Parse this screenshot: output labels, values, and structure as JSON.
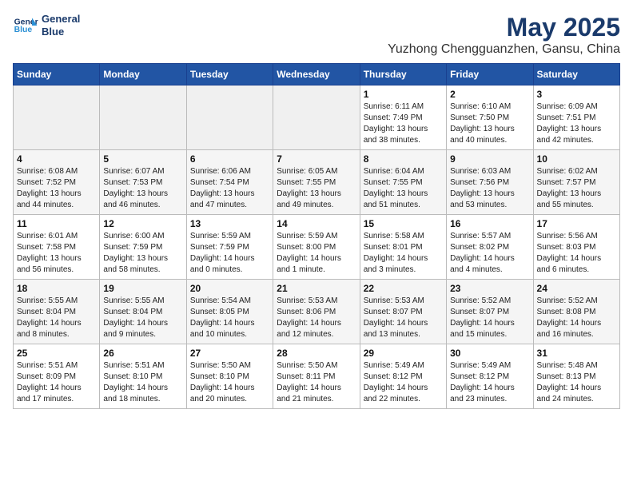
{
  "header": {
    "logo_line1": "General",
    "logo_line2": "Blue",
    "title": "May 2025",
    "subtitle": "Yuzhong Chengguanzhen, Gansu, China"
  },
  "weekdays": [
    "Sunday",
    "Monday",
    "Tuesday",
    "Wednesday",
    "Thursday",
    "Friday",
    "Saturday"
  ],
  "weeks": [
    [
      {
        "day": "",
        "info": ""
      },
      {
        "day": "",
        "info": ""
      },
      {
        "day": "",
        "info": ""
      },
      {
        "day": "",
        "info": ""
      },
      {
        "day": "1",
        "info": "Sunrise: 6:11 AM\nSunset: 7:49 PM\nDaylight: 13 hours\nand 38 minutes."
      },
      {
        "day": "2",
        "info": "Sunrise: 6:10 AM\nSunset: 7:50 PM\nDaylight: 13 hours\nand 40 minutes."
      },
      {
        "day": "3",
        "info": "Sunrise: 6:09 AM\nSunset: 7:51 PM\nDaylight: 13 hours\nand 42 minutes."
      }
    ],
    [
      {
        "day": "4",
        "info": "Sunrise: 6:08 AM\nSunset: 7:52 PM\nDaylight: 13 hours\nand 44 minutes."
      },
      {
        "day": "5",
        "info": "Sunrise: 6:07 AM\nSunset: 7:53 PM\nDaylight: 13 hours\nand 46 minutes."
      },
      {
        "day": "6",
        "info": "Sunrise: 6:06 AM\nSunset: 7:54 PM\nDaylight: 13 hours\nand 47 minutes."
      },
      {
        "day": "7",
        "info": "Sunrise: 6:05 AM\nSunset: 7:55 PM\nDaylight: 13 hours\nand 49 minutes."
      },
      {
        "day": "8",
        "info": "Sunrise: 6:04 AM\nSunset: 7:55 PM\nDaylight: 13 hours\nand 51 minutes."
      },
      {
        "day": "9",
        "info": "Sunrise: 6:03 AM\nSunset: 7:56 PM\nDaylight: 13 hours\nand 53 minutes."
      },
      {
        "day": "10",
        "info": "Sunrise: 6:02 AM\nSunset: 7:57 PM\nDaylight: 13 hours\nand 55 minutes."
      }
    ],
    [
      {
        "day": "11",
        "info": "Sunrise: 6:01 AM\nSunset: 7:58 PM\nDaylight: 13 hours\nand 56 minutes."
      },
      {
        "day": "12",
        "info": "Sunrise: 6:00 AM\nSunset: 7:59 PM\nDaylight: 13 hours\nand 58 minutes."
      },
      {
        "day": "13",
        "info": "Sunrise: 5:59 AM\nSunset: 7:59 PM\nDaylight: 14 hours\nand 0 minutes."
      },
      {
        "day": "14",
        "info": "Sunrise: 5:59 AM\nSunset: 8:00 PM\nDaylight: 14 hours\nand 1 minute."
      },
      {
        "day": "15",
        "info": "Sunrise: 5:58 AM\nSunset: 8:01 PM\nDaylight: 14 hours\nand 3 minutes."
      },
      {
        "day": "16",
        "info": "Sunrise: 5:57 AM\nSunset: 8:02 PM\nDaylight: 14 hours\nand 4 minutes."
      },
      {
        "day": "17",
        "info": "Sunrise: 5:56 AM\nSunset: 8:03 PM\nDaylight: 14 hours\nand 6 minutes."
      }
    ],
    [
      {
        "day": "18",
        "info": "Sunrise: 5:55 AM\nSunset: 8:04 PM\nDaylight: 14 hours\nand 8 minutes."
      },
      {
        "day": "19",
        "info": "Sunrise: 5:55 AM\nSunset: 8:04 PM\nDaylight: 14 hours\nand 9 minutes."
      },
      {
        "day": "20",
        "info": "Sunrise: 5:54 AM\nSunset: 8:05 PM\nDaylight: 14 hours\nand 10 minutes."
      },
      {
        "day": "21",
        "info": "Sunrise: 5:53 AM\nSunset: 8:06 PM\nDaylight: 14 hours\nand 12 minutes."
      },
      {
        "day": "22",
        "info": "Sunrise: 5:53 AM\nSunset: 8:07 PM\nDaylight: 14 hours\nand 13 minutes."
      },
      {
        "day": "23",
        "info": "Sunrise: 5:52 AM\nSunset: 8:07 PM\nDaylight: 14 hours\nand 15 minutes."
      },
      {
        "day": "24",
        "info": "Sunrise: 5:52 AM\nSunset: 8:08 PM\nDaylight: 14 hours\nand 16 minutes."
      }
    ],
    [
      {
        "day": "25",
        "info": "Sunrise: 5:51 AM\nSunset: 8:09 PM\nDaylight: 14 hours\nand 17 minutes."
      },
      {
        "day": "26",
        "info": "Sunrise: 5:51 AM\nSunset: 8:10 PM\nDaylight: 14 hours\nand 18 minutes."
      },
      {
        "day": "27",
        "info": "Sunrise: 5:50 AM\nSunset: 8:10 PM\nDaylight: 14 hours\nand 20 minutes."
      },
      {
        "day": "28",
        "info": "Sunrise: 5:50 AM\nSunset: 8:11 PM\nDaylight: 14 hours\nand 21 minutes."
      },
      {
        "day": "29",
        "info": "Sunrise: 5:49 AM\nSunset: 8:12 PM\nDaylight: 14 hours\nand 22 minutes."
      },
      {
        "day": "30",
        "info": "Sunrise: 5:49 AM\nSunset: 8:12 PM\nDaylight: 14 hours\nand 23 minutes."
      },
      {
        "day": "31",
        "info": "Sunrise: 5:48 AM\nSunset: 8:13 PM\nDaylight: 14 hours\nand 24 minutes."
      }
    ]
  ]
}
